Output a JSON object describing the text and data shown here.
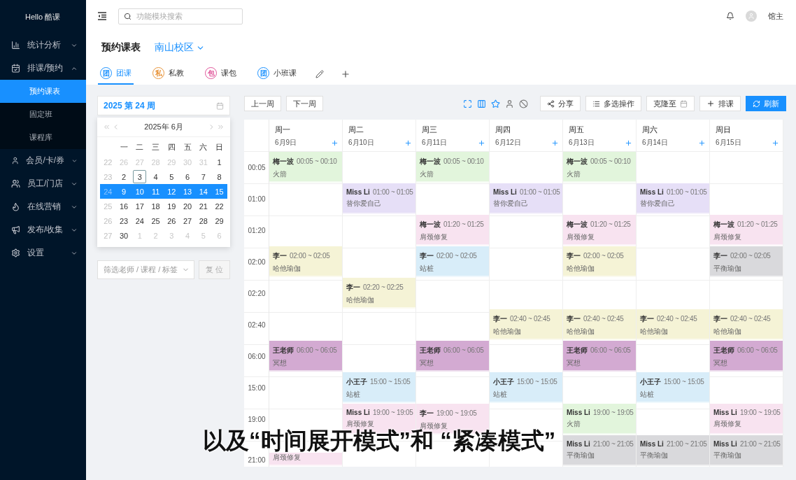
{
  "sidebar": {
    "logo": "Hello 酷课",
    "items": [
      {
        "label": "统计分析",
        "expanded": false
      },
      {
        "label": "排课/预约",
        "expanded": true,
        "children": [
          {
            "label": "预约课表",
            "selected": true
          },
          {
            "label": "固定班",
            "selected": false
          },
          {
            "label": "课程库",
            "selected": false
          }
        ]
      },
      {
        "label": "会员/卡/券",
        "expanded": false
      },
      {
        "label": "员工/门店",
        "expanded": false
      },
      {
        "label": "在线营销",
        "expanded": false
      },
      {
        "label": "发布/收集",
        "expanded": false
      },
      {
        "label": "设置",
        "expanded": false
      }
    ]
  },
  "header": {
    "search": {
      "placeholder": "功能模块搜索"
    },
    "user": "馆主"
  },
  "page": {
    "title": "预约课表",
    "campus": "南山校区"
  },
  "tabs": [
    {
      "badge": "团",
      "label": "团课",
      "color": "#1890ff",
      "selected": true
    },
    {
      "badge": "私",
      "label": "私教",
      "color": "#e8943a",
      "selected": false
    },
    {
      "badge": "包",
      "label": "课包",
      "color": "#e0559a",
      "selected": false
    },
    {
      "badge": "团",
      "label": "小班课",
      "color": "#1890ff",
      "selected": false
    }
  ],
  "week_picker": {
    "value": "2025 第 24 周",
    "month": "2025年  6月",
    "weekdays": [
      "一",
      "二",
      "三",
      "四",
      "五",
      "六",
      "日"
    ],
    "weeks": [
      {
        "week": "22",
        "selected": false,
        "days": [
          {
            "label": "26",
            "muted": true,
            "today": false
          },
          {
            "label": "27",
            "muted": true,
            "today": false
          },
          {
            "label": "28",
            "muted": true,
            "today": false
          },
          {
            "label": "29",
            "muted": true,
            "today": false
          },
          {
            "label": "30",
            "muted": true,
            "today": false
          },
          {
            "label": "31",
            "muted": true,
            "today": false
          },
          {
            "label": "1",
            "muted": false,
            "today": false
          }
        ]
      },
      {
        "week": "23",
        "selected": false,
        "days": [
          {
            "label": "2",
            "muted": false,
            "today": false
          },
          {
            "label": "3",
            "muted": false,
            "today": true
          },
          {
            "label": "4",
            "muted": false,
            "today": false
          },
          {
            "label": "5",
            "muted": false,
            "today": false
          },
          {
            "label": "6",
            "muted": false,
            "today": false
          },
          {
            "label": "7",
            "muted": false,
            "today": false
          },
          {
            "label": "8",
            "muted": false,
            "today": false
          }
        ]
      },
      {
        "week": "24",
        "selected": true,
        "days": [
          {
            "label": "9",
            "muted": false,
            "today": false
          },
          {
            "label": "10",
            "muted": false,
            "today": false
          },
          {
            "label": "11",
            "muted": false,
            "today": false
          },
          {
            "label": "12",
            "muted": false,
            "today": false
          },
          {
            "label": "13",
            "muted": false,
            "today": false
          },
          {
            "label": "14",
            "muted": false,
            "today": false
          },
          {
            "label": "15",
            "muted": false,
            "today": false
          }
        ]
      },
      {
        "week": "25",
        "selected": false,
        "days": [
          {
            "label": "16",
            "muted": false,
            "today": false
          },
          {
            "label": "17",
            "muted": false,
            "today": false
          },
          {
            "label": "18",
            "muted": false,
            "today": false
          },
          {
            "label": "19",
            "muted": false,
            "today": false
          },
          {
            "label": "20",
            "muted": false,
            "today": false
          },
          {
            "label": "21",
            "muted": false,
            "today": false
          },
          {
            "label": "22",
            "muted": false,
            "today": false
          }
        ]
      },
      {
        "week": "26",
        "selected": false,
        "days": [
          {
            "label": "23",
            "muted": false,
            "today": false
          },
          {
            "label": "24",
            "muted": false,
            "today": false
          },
          {
            "label": "25",
            "muted": false,
            "today": false
          },
          {
            "label": "26",
            "muted": false,
            "today": false
          },
          {
            "label": "27",
            "muted": false,
            "today": false
          },
          {
            "label": "28",
            "muted": false,
            "today": false
          },
          {
            "label": "29",
            "muted": false,
            "today": false
          }
        ]
      },
      {
        "week": "27",
        "selected": false,
        "days": [
          {
            "label": "30",
            "muted": false,
            "today": false
          },
          {
            "label": "1",
            "muted": true,
            "today": false
          },
          {
            "label": "2",
            "muted": true,
            "today": false
          },
          {
            "label": "3",
            "muted": true,
            "today": false
          },
          {
            "label": "4",
            "muted": true,
            "today": false
          },
          {
            "label": "5",
            "muted": true,
            "today": false
          },
          {
            "label": "6",
            "muted": true,
            "today": false
          }
        ]
      }
    ]
  },
  "filter": {
    "placeholder": "筛选老师 / 课程 / 标签",
    "reset": "复 位",
    "reset_disabled": true
  },
  "toolbar": {
    "prev": "上一周",
    "next": "下一周",
    "share": "分享",
    "multi": "多选操作",
    "clone": "克隆至",
    "schedule": "排课",
    "refresh": "刷新"
  },
  "days": [
    {
      "name": "周一",
      "date": "6月9日"
    },
    {
      "name": "周二",
      "date": "6月10日"
    },
    {
      "name": "周三",
      "date": "6月11日"
    },
    {
      "name": "周四",
      "date": "6月12日"
    },
    {
      "name": "周五",
      "date": "6月13日"
    },
    {
      "name": "周六",
      "date": "6月14日"
    },
    {
      "name": "周日",
      "date": "6月15日"
    }
  ],
  "rows": [
    {
      "time": "00:05",
      "cells": [
        {
          "teacher": "梅一波",
          "time": "00:05 ~ 00:10",
          "subject": "火箭",
          "color": "#e2f5dc"
        },
        null,
        {
          "teacher": "梅一波",
          "time": "00:05 ~ 00:10",
          "subject": "火箭",
          "color": "#e2f5dc"
        },
        null,
        {
          "teacher": "梅一波",
          "time": "00:05 ~ 00:10",
          "subject": "火箭",
          "color": "#e2f5dc"
        },
        null,
        null
      ]
    },
    {
      "time": "01:00",
      "cells": [
        null,
        {
          "teacher": "Miss Li",
          "time": "01:00 ~ 01:05",
          "subject": "替你爱自己",
          "color": "#e6dff7"
        },
        null,
        {
          "teacher": "Miss Li",
          "time": "01:00 ~ 01:05",
          "subject": "替你爱自己",
          "color": "#e6dff7"
        },
        null,
        {
          "teacher": "Miss Li",
          "time": "01:00 ~ 01:05",
          "subject": "替你爱自己",
          "color": "#e6dff7"
        },
        null
      ]
    },
    {
      "time": "01:20",
      "cells": [
        null,
        null,
        {
          "teacher": "梅一波",
          "time": "01:20 ~ 01:25",
          "subject": "肩颈修复",
          "color": "#f8e3f0"
        },
        null,
        {
          "teacher": "梅一波",
          "time": "01:20 ~ 01:25",
          "subject": "肩颈修复",
          "color": "#f8e3f0"
        },
        null,
        {
          "teacher": "梅一波",
          "time": "01:20 ~ 01:25",
          "subject": "肩颈修复",
          "color": "#f8e3f0"
        }
      ]
    },
    {
      "time": "02:00",
      "cells": [
        {
          "teacher": "李一",
          "time": "02:00 ~ 02:05",
          "subject": "哈他瑜伽",
          "color": "#f5f3d6"
        },
        null,
        {
          "teacher": "李一",
          "time": "02:00 ~ 02:05",
          "subject": "站桩",
          "color": "#d8edf9"
        },
        null,
        {
          "teacher": "李一",
          "time": "02:00 ~ 02:05",
          "subject": "哈他瑜伽",
          "color": "#f5f3d6"
        },
        null,
        {
          "teacher": "李一",
          "time": "02:00 ~ 02:05",
          "subject": "平衡瑜伽",
          "color": "#d9d9dc"
        }
      ]
    },
    {
      "time": "02:20",
      "cells": [
        null,
        {
          "teacher": "李一",
          "time": "02:20 ~ 02:25",
          "subject": "哈他瑜伽",
          "color": "#f5f3d6"
        },
        null,
        null,
        null,
        null,
        null
      ]
    },
    {
      "time": "02:40",
      "cells": [
        null,
        null,
        null,
        {
          "teacher": "李一",
          "time": "02:40 ~ 02:45",
          "subject": "哈他瑜伽",
          "color": "#f5f3d6"
        },
        {
          "teacher": "李一",
          "time": "02:40 ~ 02:45",
          "subject": "哈他瑜伽",
          "color": "#f5f3d6"
        },
        {
          "teacher": "李一",
          "time": "02:40 ~ 02:45",
          "subject": "哈他瑜伽",
          "color": "#f5f3d6"
        },
        {
          "teacher": "李一",
          "time": "02:40 ~ 02:45",
          "subject": "哈他瑜伽",
          "color": "#f5f3d6"
        }
      ]
    },
    {
      "time": "06:00",
      "cells": [
        {
          "teacher": "王老师",
          "time": "06:00 ~ 06:05",
          "subject": "冥想",
          "color": "#d3aad2"
        },
        null,
        {
          "teacher": "王老师",
          "time": "06:00 ~ 06:05",
          "subject": "冥想",
          "color": "#d3aad2"
        },
        null,
        {
          "teacher": "王老师",
          "time": "06:00 ~ 06:05",
          "subject": "冥想",
          "color": "#d3aad2"
        },
        null,
        {
          "teacher": "王老师",
          "time": "06:00 ~ 06:05",
          "subject": "冥想",
          "color": "#d3aad2"
        }
      ]
    },
    {
      "time": "15:00",
      "cells": [
        null,
        {
          "teacher": "小王子",
          "time": "15:00 ~ 15:05",
          "subject": "站桩",
          "color": "#d8edf9"
        },
        null,
        {
          "teacher": "小王子",
          "time": "15:00 ~ 15:05",
          "subject": "站桩",
          "color": "#d8edf9"
        },
        null,
        {
          "teacher": "小王子",
          "time": "15:00 ~ 15:05",
          "subject": "站桩",
          "color": "#d8edf9"
        },
        null
      ]
    },
    {
      "time": "19:00",
      "cells": [
        null,
        {
          "teacher": "Miss Li",
          "time": "19:00 ~ 19:05",
          "subject": "肩颈修复",
          "color": "#f8e3f0"
        },
        {
          "teacher": "李一",
          "time": "19:00 ~ 19:05",
          "subject": "肩颈修复",
          "color": "#f8e3f0"
        },
        null,
        {
          "teacher": "Miss Li",
          "time": "19:00 ~ 19:05",
          "subject": "火箭",
          "color": "#e2f5dc"
        },
        null,
        {
          "teacher": "Miss Li",
          "time": "19:00 ~ 19:05",
          "subject": "肩颈修复",
          "color": "#f8e3f0"
        }
      ]
    },
    {
      "time": "21:00",
      "cells": [
        {
          "subject": "肩颈修复",
          "color": "#f8e3f0"
        },
        null,
        null,
        null,
        {
          "teacher": "Miss Li",
          "time": "21:00 ~ 21:05",
          "subject": "平衡瑜伽",
          "color": "#d9d9dc"
        },
        {
          "teacher": "Miss Li",
          "time": "21:00 ~ 21:05",
          "subject": "平衡瑜伽",
          "color": "#d9d9dc"
        },
        {
          "teacher": "Miss Li",
          "time": "21:00 ~ 21:05",
          "subject": "平衡瑜伽",
          "color": "#d9d9dc"
        }
      ]
    }
  ],
  "caption": "以及“时间展开模式”和 “紧凑模式”"
}
